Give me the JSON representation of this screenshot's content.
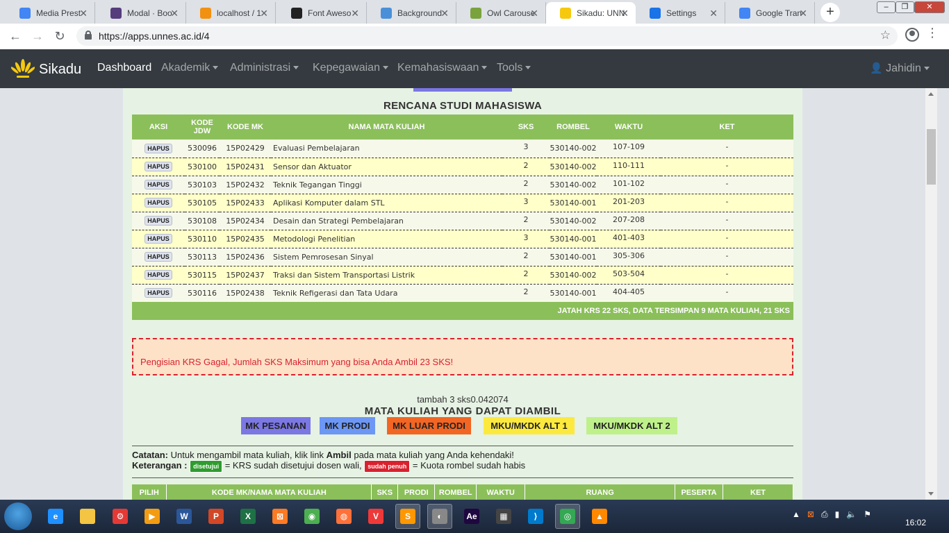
{
  "browser": {
    "tabs": [
      {
        "title": "Media Prest",
        "icon": "feather-icon",
        "color": "#4285f4"
      },
      {
        "title": "Modal · Boo",
        "icon": "bootstrap-icon",
        "color": "#563d7c"
      },
      {
        "title": "localhost / 1",
        "icon": "phpmyadmin-icon",
        "color": "#f29111"
      },
      {
        "title": "Font Aweso",
        "icon": "flag-icon",
        "color": "#222222"
      },
      {
        "title": "Background",
        "icon": "cog-icon",
        "color": "#4a90d9"
      },
      {
        "title": "Owl Carouse",
        "icon": "owl-icon",
        "color": "#7aa33e"
      },
      {
        "title": "Sikadu: UNN",
        "icon": "unnes-icon",
        "color": "#f6c90e"
      },
      {
        "title": "Settings",
        "icon": "gear-icon",
        "color": "#1a73e8"
      },
      {
        "title": "Google Tran",
        "icon": "translate-icon",
        "color": "#4285f4"
      }
    ],
    "url": "https://apps.unnes.ac.id/4"
  },
  "navbar": {
    "brand": "Sikadu",
    "items": [
      {
        "label": "Dashboard",
        "dropdown": false
      },
      {
        "label": "Akademik",
        "dropdown": true
      },
      {
        "label": "Administrasi",
        "dropdown": true
      },
      {
        "label": "Kepegawaian",
        "dropdown": true
      },
      {
        "label": "Kemahasiswaan",
        "dropdown": true
      },
      {
        "label": "Tools",
        "dropdown": true
      }
    ],
    "user": "Jahidin"
  },
  "krs": {
    "title": "RENCANA STUDI MAHASISWA",
    "headers": {
      "aksi": "AKSI",
      "kode_jdw_1": "KODE",
      "kode_jdw_2": "JDW",
      "kode_mk": "KODE MK",
      "nama": "NAMA MATA KULIAH",
      "sks": "SKS",
      "rombel": "ROMBEL",
      "waktu": "WAKTU",
      "ket": "KET"
    },
    "action_label": "HAPUS",
    "rows": [
      {
        "jdw": "530096",
        "mk": "15P02429",
        "nama": "Evaluasi Pembelajaran",
        "sks": "3",
        "rombel": "530140-002",
        "waktu": "107-109",
        "ket": "-"
      },
      {
        "jdw": "530100",
        "mk": "15P02431",
        "nama": "Sensor dan Aktuator",
        "sks": "2",
        "rombel": "530140-002",
        "waktu": "110-111",
        "ket": "-"
      },
      {
        "jdw": "530103",
        "mk": "15P02432",
        "nama": "Teknik Tegangan Tinggi",
        "sks": "2",
        "rombel": "530140-002",
        "waktu": "101-102",
        "ket": "-"
      },
      {
        "jdw": "530105",
        "mk": "15P02433",
        "nama": "Aplikasi Komputer dalam STL",
        "sks": "3",
        "rombel": "530140-001",
        "waktu": "201-203",
        "ket": "-"
      },
      {
        "jdw": "530108",
        "mk": "15P02434",
        "nama": "Desain dan Strategi Pembelajaran",
        "sks": "2",
        "rombel": "530140-002",
        "waktu": "207-208",
        "ket": "-"
      },
      {
        "jdw": "530110",
        "mk": "15P02435",
        "nama": "Metodologi Penelitian",
        "sks": "3",
        "rombel": "530140-001",
        "waktu": "401-403",
        "ket": "-"
      },
      {
        "jdw": "530113",
        "mk": "15P02436",
        "nama": "Sistem Pemrosesan Sinyal",
        "sks": "2",
        "rombel": "530140-001",
        "waktu": "305-306",
        "ket": "-"
      },
      {
        "jdw": "530115",
        "mk": "15P02437",
        "nama": "Traksi dan Sistem Transportasi Listrik",
        "sks": "2",
        "rombel": "530140-002",
        "waktu": "503-504",
        "ket": "-"
      },
      {
        "jdw": "530116",
        "mk": "15P02438",
        "nama": "Teknik Refigerasi dan Tata Udara",
        "sks": "2",
        "rombel": "530140-001",
        "waktu": "404-405",
        "ket": "-"
      }
    ],
    "footer": "JATAH KRS 22 SKS, DATA TERSIMPAN 9 MATA KULIAH, 21 SKS"
  },
  "alert": "Pengisian KRS Gagal, Jumlah SKS Maksimum yang bisa Anda Ambil 23 SKS!",
  "tambah": "tambah 3 sks0.042074",
  "mk": {
    "title": "MATA KULIAH YANG DAPAT DIAMBIL",
    "categories": [
      {
        "label": "MK PESANAN",
        "color": "#7b77e3"
      },
      {
        "label": "MK PRODI",
        "color": "#6c97f5"
      },
      {
        "label": "MK LUAR PRODI",
        "color": "#f26522"
      },
      {
        "label": "MKU/MKDK ALT 1",
        "color": "#fce93e"
      },
      {
        "label": "MKU/MKDK ALT 2",
        "color": "#bff18a"
      }
    ],
    "catatan_label": "Catatan:",
    "catatan_pre": " Untuk mengambil mata kuliah, klik link ",
    "catatan_bold": "Ambil",
    "catatan_post": " pada mata kuliah yang Anda kehendaki!",
    "keterangan_label": "Keterangan :",
    "badge_disetujui": "disetujui",
    "desc_disetujui": " = KRS sudah disetujui dosen wali, ",
    "badge_penuh": "sudah penuh",
    "desc_penuh": " = Kuota rombel sudah habis",
    "headers": [
      "PILIH",
      "KODE MK/NAMA MATA KULIAH",
      "SKS",
      "PRODI",
      "ROMBEL",
      "WAKTU",
      "RUANG",
      "PESERTA",
      "KET"
    ]
  },
  "taskbar": {
    "apps": [
      {
        "icon": "ie-icon",
        "color": "#1e90ff",
        "glyph": "e"
      },
      {
        "icon": "explorer-icon",
        "color": "#f4c542",
        "glyph": ""
      },
      {
        "icon": "settings-app-icon",
        "color": "#e53935",
        "glyph": "⚙"
      },
      {
        "icon": "media-player-icon",
        "color": "#f39c12",
        "glyph": "▶"
      },
      {
        "icon": "word-icon",
        "color": "#2b579a",
        "glyph": "W"
      },
      {
        "icon": "powerpoint-icon",
        "color": "#d24726",
        "glyph": "P"
      },
      {
        "icon": "excel-icon",
        "color": "#1e7145",
        "glyph": "X"
      },
      {
        "icon": "xampp-icon",
        "color": "#fb7a24",
        "glyph": "⊠"
      },
      {
        "icon": "wifi-app-icon",
        "color": "#4caf50",
        "glyph": "◉"
      },
      {
        "icon": "firefox-icon",
        "color": "#ff7139",
        "glyph": "◍"
      },
      {
        "icon": "vivaldi-icon",
        "color": "#ef3939",
        "glyph": "V"
      },
      {
        "icon": "sublime-icon",
        "color": "#ff9800",
        "glyph": "S"
      },
      {
        "icon": "inkscape-icon",
        "color": "#888888",
        "glyph": "◐"
      },
      {
        "icon": "after-effects-icon",
        "color": "#1f0740",
        "glyph": "Ae"
      },
      {
        "icon": "calculator-icon",
        "color": "#444444",
        "glyph": "▦"
      },
      {
        "icon": "vscode-icon",
        "color": "#007acc",
        "glyph": "⟩"
      },
      {
        "icon": "chrome-icon",
        "color": "#34a853",
        "glyph": "◎"
      },
      {
        "icon": "vlc-icon",
        "color": "#ff8800",
        "glyph": "▲"
      }
    ],
    "clock": "16:02"
  }
}
